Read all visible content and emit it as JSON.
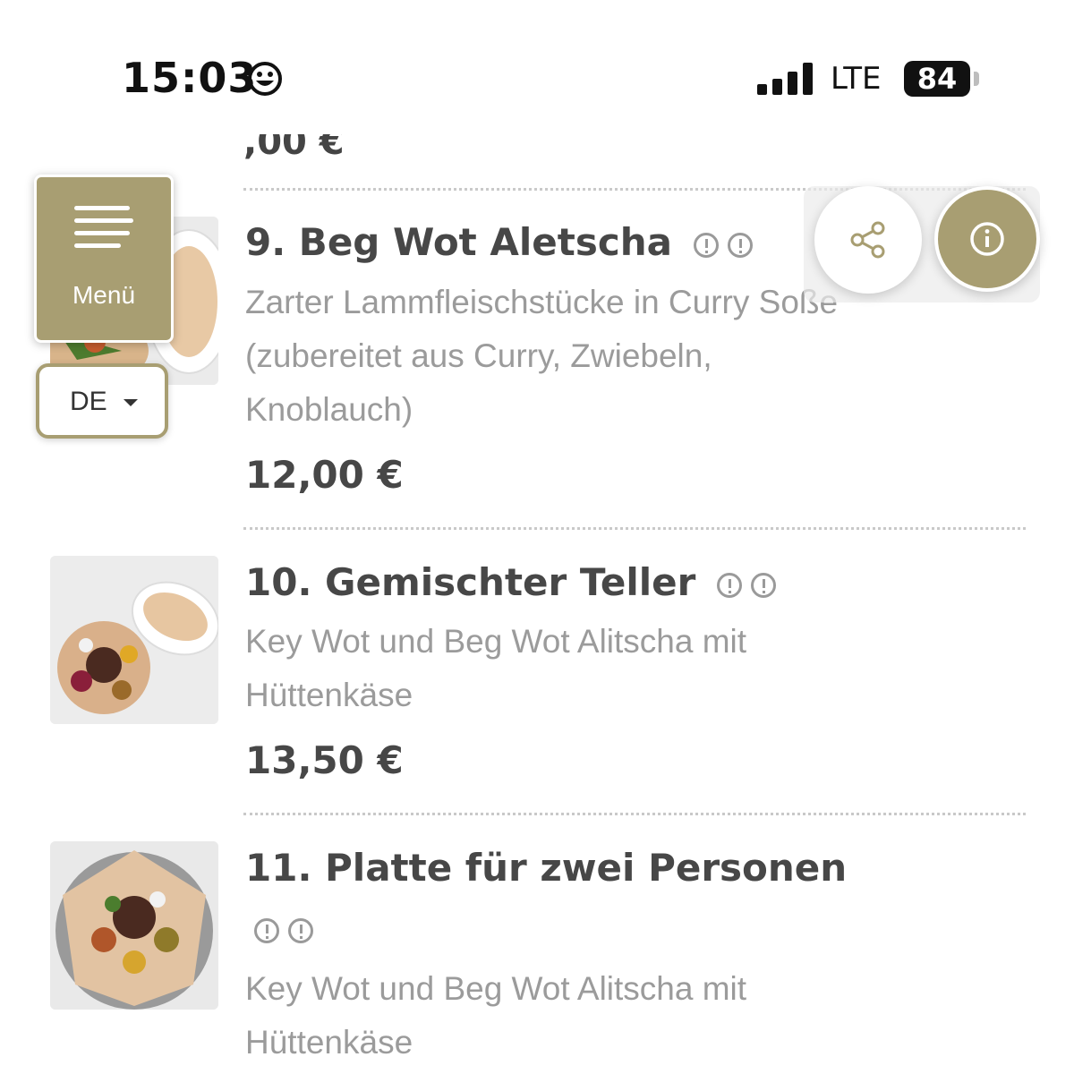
{
  "status_bar": {
    "time": "15:03",
    "network": "LTE",
    "battery": "84",
    "emoji_icon": "smiley-icon"
  },
  "controls": {
    "menu_label": "Menü",
    "language": "DE",
    "share_icon": "share-icon",
    "info_icon": "info-icon",
    "accent_color": "#a89e72"
  },
  "previous_price_fragment": ",00 €",
  "items": [
    {
      "title": "9. Beg Wot Aletscha",
      "description": "Zarter Lammfleischstücke in Curry Soße (zubereitet aus Curry, Zwiebeln, Knoblauch)",
      "price": "12,00 €"
    },
    {
      "title": "10. Gemischter Teller",
      "description": "Key Wot und Beg Wot Alitscha mit Hüttenkäse",
      "price": "13,50 €"
    },
    {
      "title": "11. Platte für zwei Personen",
      "description": "Key Wot und Beg Wot Alitscha mit Hüttenkäse"
    }
  ]
}
